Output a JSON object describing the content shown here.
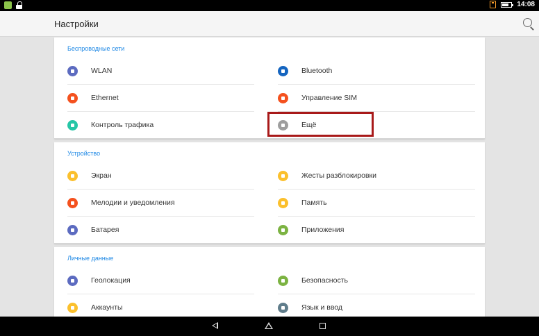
{
  "statusbar": {
    "time": "14:08",
    "icons": [
      "app-notification-icon",
      "lock-icon",
      "notification-icon",
      "battery-icon"
    ]
  },
  "appbar": {
    "title": "Настройки",
    "search_icon": "search-icon"
  },
  "sections": [
    {
      "header": "Беспроводные сети",
      "items": [
        {
          "label": "WLAN",
          "icon": "wifi-icon",
          "color": "#5c6bc0"
        },
        {
          "label": "Bluetooth",
          "icon": "bluetooth-icon",
          "color": "#1565c0"
        },
        {
          "label": "Ethernet",
          "icon": "ethernet-icon",
          "color": "#f4511e"
        },
        {
          "label": "Управление SIM",
          "icon": "sim-icon",
          "color": "#f4511e"
        },
        {
          "label": "Контроль трафика",
          "icon": "traffic-icon",
          "color": "#26c6a6"
        },
        {
          "label": "Ещё",
          "icon": "more-icon",
          "color": "#9e9e9e"
        }
      ]
    },
    {
      "header": "Устройство",
      "items": [
        {
          "label": "Экран",
          "icon": "display-icon",
          "color": "#fbc02d"
        },
        {
          "label": "Жесты разблокировки",
          "icon": "gesture-icon",
          "color": "#fbc02d"
        },
        {
          "label": "Мелодии и уведомления",
          "icon": "bell-icon",
          "color": "#f4511e"
        },
        {
          "label": "Память",
          "icon": "storage-icon",
          "color": "#fbc02d"
        },
        {
          "label": "Батарея",
          "icon": "battery-icon",
          "color": "#5c6bc0"
        },
        {
          "label": "Приложения",
          "icon": "apps-icon",
          "color": "#7cb342"
        }
      ]
    },
    {
      "header": "Личные данные",
      "items": [
        {
          "label": "Геолокация",
          "icon": "location-icon",
          "color": "#5c6bc0"
        },
        {
          "label": "Безопасность",
          "icon": "security-icon",
          "color": "#7cb342"
        },
        {
          "label": "Аккаунты",
          "icon": "account-icon",
          "color": "#fbc02d"
        },
        {
          "label": "Язык и ввод",
          "icon": "language-icon",
          "color": "#607d8b"
        }
      ]
    }
  ],
  "colors": {
    "accent": "#1e88e5",
    "highlight": "#a81919"
  },
  "navbar": {
    "icons": [
      "back-icon",
      "home-icon",
      "recents-icon"
    ]
  }
}
